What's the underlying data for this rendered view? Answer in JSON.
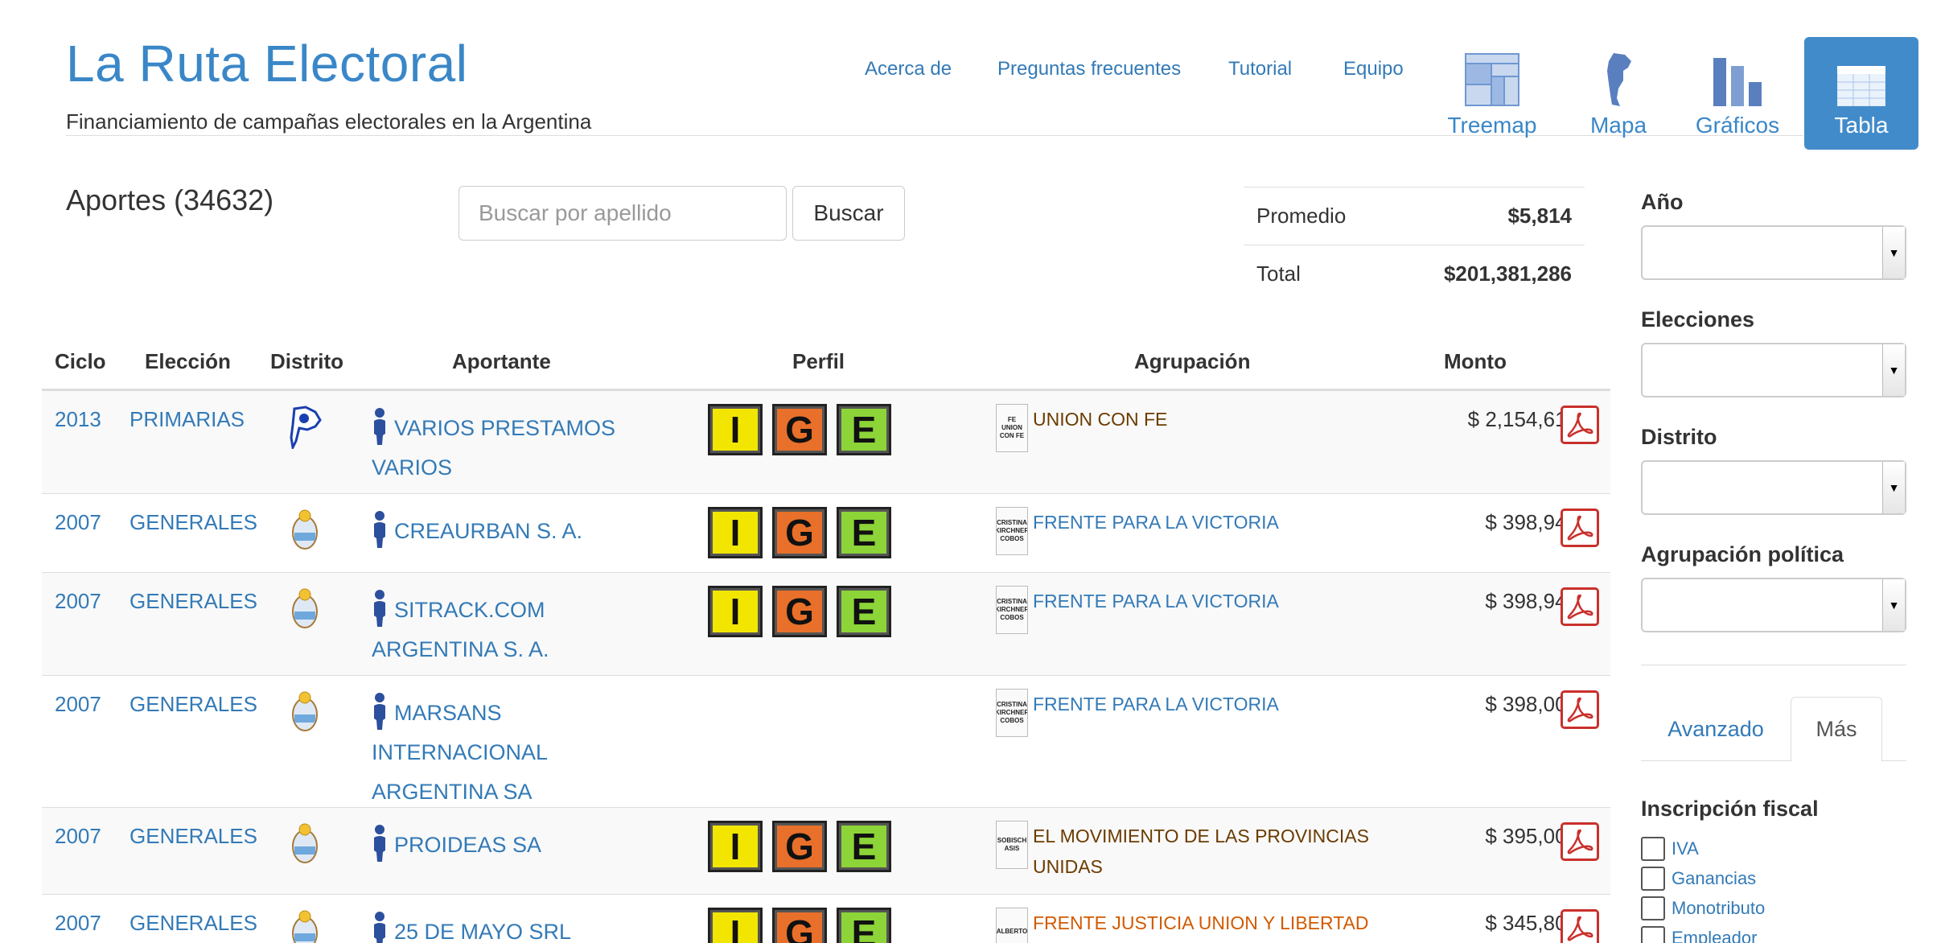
{
  "header": {
    "brand": "La Ruta Electoral",
    "tagline": "Financiamiento de campañas electorales en la Argentina",
    "text_nav": [
      "Acerca de",
      "Preguntas frecuentes",
      "Tutorial",
      "Equipo"
    ],
    "icon_nav": [
      {
        "label": "Treemap",
        "icon": "treemap-icon",
        "active": false
      },
      {
        "label": "Mapa",
        "icon": "map-icon",
        "active": false
      },
      {
        "label": "Gráficos",
        "icon": "bar-chart-icon",
        "active": false
      },
      {
        "label": "Tabla",
        "icon": "table-icon",
        "active": true
      }
    ]
  },
  "main": {
    "title": "Aportes (34632)",
    "search": {
      "placeholder": "Buscar por apellido",
      "button": "Buscar"
    },
    "stats": [
      {
        "label": "Promedio",
        "value": "$5,814"
      },
      {
        "label": "Total",
        "value": "$201,381,286"
      }
    ]
  },
  "table": {
    "columns": [
      "Ciclo",
      "Elección",
      "Distrito",
      "Aportante",
      "Perfil",
      "Agrupación",
      "Monto"
    ],
    "rows": [
      {
        "ciclo": "2013",
        "eleccion": "PRIMARIAS",
        "distrito_icon": "province-map-icon",
        "aportante_lines": [
          "VARIOS PRESTAMOS",
          "VARIOS"
        ],
        "perfil": [
          "I",
          "G",
          "E"
        ],
        "agrupacion": [
          "UNION CON FE"
        ],
        "agrupacion_color": "#6b3b00",
        "poster_icon": "ballot-poster-icon",
        "monto": "$ 2,154,610"
      },
      {
        "ciclo": "2007",
        "eleccion": "GENERALES",
        "distrito_icon": "national-seal-icon",
        "aportante_lines": [
          "CREAURBAN S. A."
        ],
        "perfil": [
          "I",
          "G",
          "E"
        ],
        "agrupacion": [
          "FRENTE PARA LA VICTORIA"
        ],
        "agrupacion_color": "#337ab7",
        "poster_icon": "ballot-poster-icon",
        "monto": "$ 398,948"
      },
      {
        "ciclo": "2007",
        "eleccion": "GENERALES",
        "distrito_icon": "national-seal-icon",
        "aportante_lines": [
          "SITRACK.COM",
          "ARGENTINA S. A."
        ],
        "perfil": [
          "I",
          "G",
          "E"
        ],
        "agrupacion": [
          "FRENTE PARA LA VICTORIA"
        ],
        "agrupacion_color": "#337ab7",
        "poster_icon": "ballot-poster-icon",
        "monto": "$ 398,948"
      },
      {
        "ciclo": "2007",
        "eleccion": "GENERALES",
        "distrito_icon": "national-seal-icon",
        "aportante_lines": [
          "MARSANS",
          "INTERNACIONAL",
          "ARGENTINA SA"
        ],
        "perfil": [],
        "agrupacion": [
          "FRENTE PARA LA VICTORIA"
        ],
        "agrupacion_color": "#337ab7",
        "poster_icon": "ballot-poster-icon",
        "monto": "$ 398,000"
      },
      {
        "ciclo": "2007",
        "eleccion": "GENERALES",
        "distrito_icon": "national-seal-icon",
        "aportante_lines": [
          "PROIDEAS SA"
        ],
        "perfil": [
          "I",
          "G",
          "E"
        ],
        "agrupacion": [
          "EL MOVIMIENTO DE LAS PROVINCIAS",
          "UNIDAS"
        ],
        "agrupacion_color": "#6b3b00",
        "poster_icon": "ballot-poster-icon",
        "monto": "$ 395,000"
      },
      {
        "ciclo": "2007",
        "eleccion": "GENERALES",
        "distrito_icon": "national-seal-icon",
        "aportante_lines": [
          "25 DE MAYO SRL"
        ],
        "perfil": [
          "I",
          "G",
          "E"
        ],
        "agrupacion": [
          "FRENTE JUSTICIA UNION Y LIBERTAD"
        ],
        "agrupacion_color": "#d25a00",
        "poster_icon": "ballot-poster-icon",
        "monto": "$ 345,800"
      }
    ],
    "poster_texts": [
      [
        "FE",
        "UNION",
        "CON FE"
      ],
      [
        "CRISTINA",
        "KIRCHNER",
        "COBOS"
      ],
      [
        "CRISTINA",
        "KIRCHNER",
        "COBOS"
      ],
      [
        "CRISTINA",
        "KIRCHNER",
        "COBOS"
      ],
      [
        "SOBISCH",
        "ASIS"
      ],
      [
        "ALBERTO"
      ]
    ]
  },
  "sidebar": {
    "filters": [
      {
        "label": "Año",
        "value": ""
      },
      {
        "label": "Elecciones",
        "value": ""
      },
      {
        "label": "Distrito",
        "value": ""
      },
      {
        "label": "Agrupación política",
        "value": ""
      }
    ],
    "tabs": [
      "Avanzado",
      "Más"
    ],
    "active_tab": "Más",
    "section_title": "Inscripción fiscal",
    "checkboxes": [
      "IVA",
      "Ganancias",
      "Monotributo",
      "Empleador"
    ]
  },
  "colors": {
    "brand": "#3a87c8",
    "link": "#337ab7",
    "active_nav": "#428bca",
    "badge_i": "#f2e600",
    "badge_g": "#e8702a",
    "badge_e": "#8cd437",
    "pdf": "#c9302c"
  }
}
